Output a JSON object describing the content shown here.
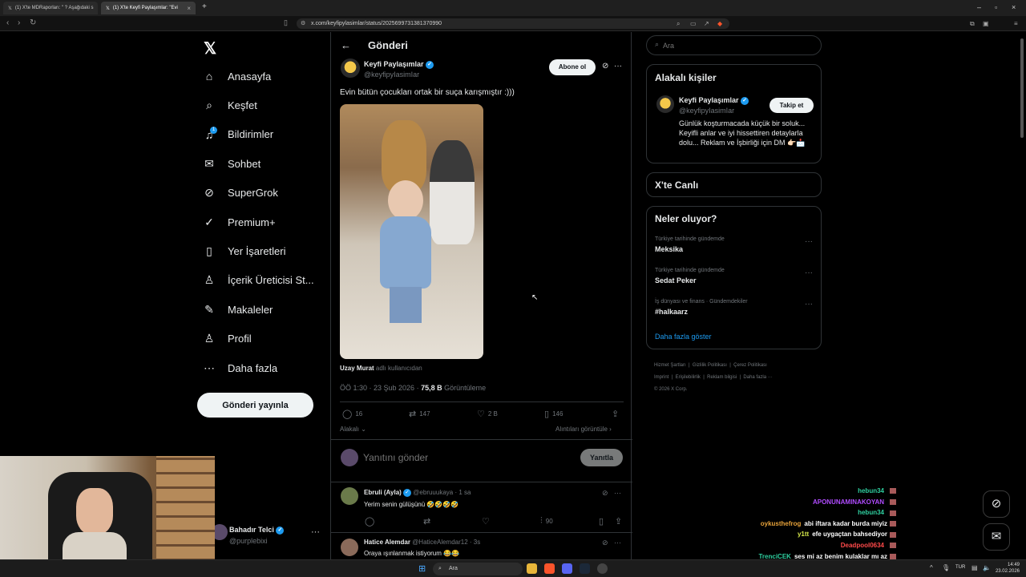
{
  "browser": {
    "tabs": [
      {
        "label": "(1) X'te MDRaporları: \" ? Aşağıdaki s"
      },
      {
        "label": "(1) X'te Keyfi Paylaşımlar: \"Evi"
      }
    ],
    "url": "x.com/keyfipylasimlar/status/2025699731381370990"
  },
  "nav": {
    "items": [
      {
        "label": "Anasayfa",
        "icon": "home-icon"
      },
      {
        "label": "Keşfet",
        "icon": "search-icon"
      },
      {
        "label": "Bildirimler",
        "icon": "bell-icon",
        "badge": "1"
      },
      {
        "label": "Sohbet",
        "icon": "mail-icon"
      },
      {
        "label": "SuperGrok",
        "icon": "grok-icon"
      },
      {
        "label": "Premium+",
        "icon": "premium-icon"
      },
      {
        "label": "Yer İşaretleri",
        "icon": "bookmark-icon"
      },
      {
        "label": "İçerik Üreticisi St...",
        "icon": "creator-icon"
      },
      {
        "label": "Makaleler",
        "icon": "article-icon"
      },
      {
        "label": "Profil",
        "icon": "profile-icon"
      },
      {
        "label": "Daha fazla",
        "icon": "more-icon"
      }
    ],
    "post_button": "Gönderi yayınla",
    "account": {
      "name": "Bahadır Telci",
      "handle": "@purplebixi"
    }
  },
  "post": {
    "header_title": "Gönderi",
    "author_name": "Keyfi Paylaşımlar",
    "author_handle": "@keyfipyIasimIar",
    "subscribe_label": "Abone ol",
    "text": "Evin bütün çocukları ortak bir suça karışmıştır :)))",
    "media_credit_name": "Uzay Murat",
    "media_credit_suffix": "adlı kullanıcıdan",
    "meta_time": "ÖÖ 1:30 · 23 Şub 2026 ·",
    "meta_views": "75,8 B",
    "meta_views_label": "Görüntüleme",
    "replies": "16",
    "reposts": "147",
    "likes": "2 B",
    "bookmarks": "146",
    "relevant_label": "Alakalı",
    "quotes_label": "Alıntıları görüntüle",
    "reply_placeholder": "Yanıtını gönder",
    "reply_button": "Yanıtla"
  },
  "replies": [
    {
      "name": "Ebruli (Ayla)",
      "handle": "@ebruuukaya",
      "time": "· 1 sa",
      "text": "Yerim senin gülüşünü 🤣🤣🤣🤣",
      "views": "90"
    },
    {
      "name": "Hatice Alemdar",
      "handle": "@HaticeAlemdar12",
      "time": "· 3s",
      "text": "Oraya ışınlanmak istiyorum 😂😂"
    }
  ],
  "search": {
    "placeholder": "Ara"
  },
  "related": {
    "title": "Alakalı kişiler",
    "name": "Keyfi Paylaşımlar",
    "handle": "@keyfipyIasimIar",
    "follow_label": "Takip et",
    "bio": "Günlük koşturmacada küçük bir soluk... Keyifli anlar ve iyi hissettiren detaylarla dolu... Reklam ve İşbirliği için DM 👉🏻📩"
  },
  "live": {
    "title": "X'te Canlı"
  },
  "trends": {
    "title": "Neler oluyor?",
    "items": [
      {
        "category": "Türkiye tarihinde gündemde",
        "name": "Meksika"
      },
      {
        "category": "Türkiye tarihinde gündemde",
        "name": "Sedat Peker"
      },
      {
        "category": "İş dünyası ve finans · Gündemdekiler",
        "name": "#halkaarz"
      }
    ],
    "show_more": "Daha fazla göster"
  },
  "footer": {
    "links": [
      "Hizmet Şartları",
      "Gizlilik Politikası",
      "Çerez Politikası",
      "Imprint",
      "Erişilebilirlik",
      "Reklam bilgisi",
      "Daha fazla ···"
    ],
    "copyright": "© 2026 X Corp."
  },
  "chat": [
    {
      "user": "hebun34",
      "msg": "",
      "color": "#2fd0a0"
    },
    {
      "user": "APONUNAMINAKOYAN",
      "msg": "",
      "color": "#b04cff"
    },
    {
      "user": "hebun34",
      "msg": "",
      "color": "#2fd0a0"
    },
    {
      "user": "oykusthefrog",
      "msg": "abi iftara kadar burda miyiz",
      "color": "#e7a23a"
    },
    {
      "user": "y1tt",
      "msg": "efe uygaçtan bahsediyor",
      "color": "#d6e84b"
    },
    {
      "user": "Deadpool0634",
      "msg": "",
      "color": "#ff4a4a"
    },
    {
      "user": "TrenciCEK",
      "msg": "ses mi az benim kulaklar mı az",
      "color": "#2fd0a0"
    },
    {
      "user": "",
      "msg": "dutyuyop",
      "color": "#ffffff"
    }
  ],
  "taskbar": {
    "search": "Ara",
    "lang": "TUR",
    "time": "14:49",
    "date": "23.02.2026"
  },
  "colors": {
    "accent": "#1d9bf0",
    "background": "#000000",
    "border": "#2f3336",
    "muted": "#71767b"
  }
}
